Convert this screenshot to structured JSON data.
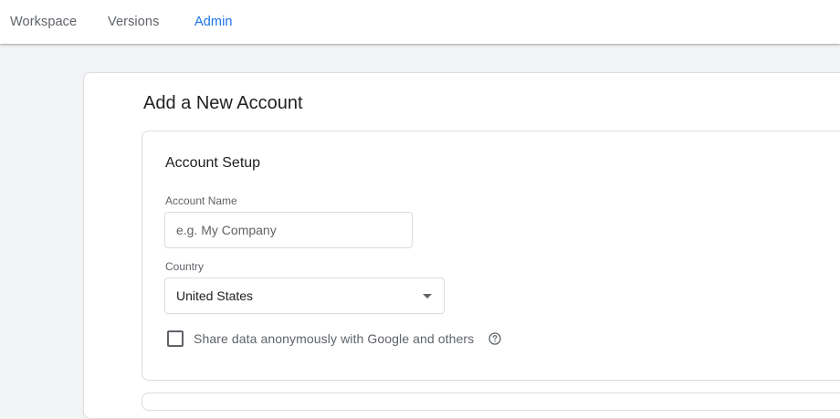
{
  "nav": {
    "tabs": [
      {
        "label": "Workspace",
        "active": false
      },
      {
        "label": "Versions",
        "active": false
      },
      {
        "label": "Admin",
        "active": true
      }
    ]
  },
  "page": {
    "title": "Add a New Account"
  },
  "account_setup": {
    "section_title": "Account Setup",
    "account_name": {
      "label": "Account Name",
      "value": "",
      "placeholder": "e.g. My Company"
    },
    "country": {
      "label": "Country",
      "selected": "United States",
      "icon": "arrow-drop-down-icon"
    },
    "share_data": {
      "label": "Share data anonymously with Google and others",
      "checked": false,
      "help_icon": "help-circle-icon"
    }
  },
  "colors": {
    "accent": "#1a73e8",
    "text_primary": "#202124",
    "text_secondary": "#5f6368",
    "border": "#dadce0",
    "background": "#f1f3f4"
  }
}
